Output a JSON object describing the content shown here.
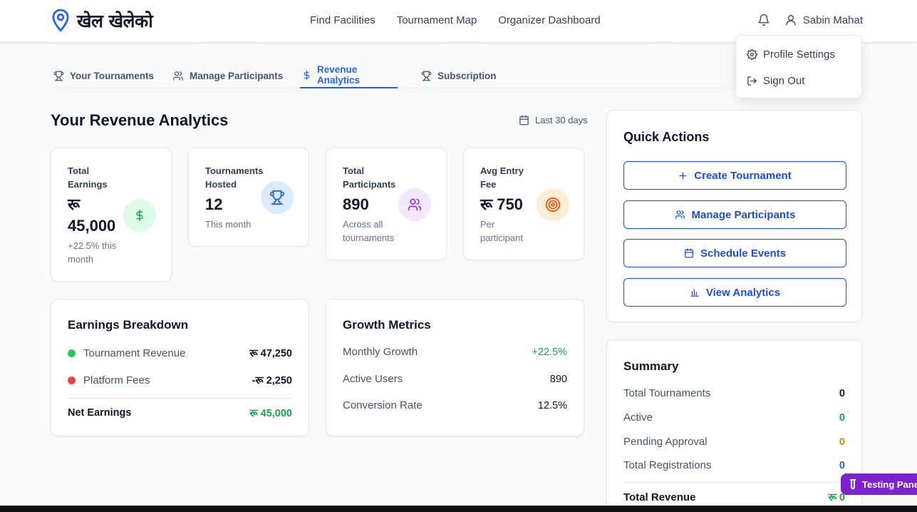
{
  "brand": {
    "name": "खेल खेलेको"
  },
  "nav": {
    "items": [
      "Find Facilities",
      "Tournament Map",
      "Organizer Dashboard"
    ]
  },
  "user": {
    "name": "Sabin Mahat"
  },
  "dropdown": {
    "items": [
      "Profile Settings",
      "Sign Out"
    ]
  },
  "tabs": [
    "Your Tournaments",
    "Manage Participants",
    "Revenue Analytics",
    "Subscription"
  ],
  "active_tab": "Revenue Analytics",
  "page": {
    "title": "Your Revenue Analytics",
    "date_range": "Last 30 days"
  },
  "stats": [
    {
      "label_line1": "Total",
      "label_line2": "Earnings",
      "value_line1": "रू",
      "value_line2": "45,000",
      "sub_line1": "+22.5% this",
      "sub_line2": "month"
    },
    {
      "label_line1": "Tournaments",
      "label_line2": "Hosted",
      "value": "12",
      "sub": "This month"
    },
    {
      "label_line1": "Total",
      "label_line2": "Participants",
      "value": "890",
      "sub_line1": "Across all",
      "sub_line2": "tournaments"
    },
    {
      "label_line1": "Avg Entry",
      "label_line2": "Fee",
      "value": "रू 750",
      "sub_line1": "Per",
      "sub_line2": "participant"
    }
  ],
  "earnings_breakdown": {
    "title": "Earnings Breakdown",
    "rows": [
      {
        "label": "Tournament Revenue",
        "value": "रू 47,250",
        "dot_color": "#22c55e"
      },
      {
        "label": "Platform Fees",
        "value": "-रू 2,250",
        "dot_color": "#ef4444"
      }
    ],
    "net_label": "Net Earnings",
    "net_value": "रू 45,000"
  },
  "growth_metrics": {
    "title": "Growth Metrics",
    "rows": [
      {
        "label": "Monthly Growth",
        "value": "+22.5%"
      },
      {
        "label": "Active Users",
        "value": "890"
      },
      {
        "label": "Conversion Rate",
        "value": "12.5%"
      }
    ]
  },
  "quick_actions": {
    "title": "Quick Actions",
    "buttons": [
      "Create Tournament",
      "Manage Participants",
      "Schedule Events",
      "View Analytics"
    ]
  },
  "summary": {
    "title": "Summary",
    "rows": [
      {
        "label": "Total Tournaments",
        "value": "0",
        "color": "#0f172a"
      },
      {
        "label": "Active",
        "value": "0",
        "color": "#16a34a"
      },
      {
        "label": "Pending Approval",
        "value": "0",
        "color": "#ca8a04"
      },
      {
        "label": "Total Registrations",
        "value": "0",
        "color": "#2563eb"
      }
    ],
    "total_label": "Total Revenue",
    "total_value": "रू 0"
  },
  "testing_panel": {
    "label": "Testing Panel"
  },
  "colors": {
    "accent": "#2563eb",
    "green": "#16a34a",
    "red": "#ef4444",
    "purple": "#7e22ce"
  }
}
